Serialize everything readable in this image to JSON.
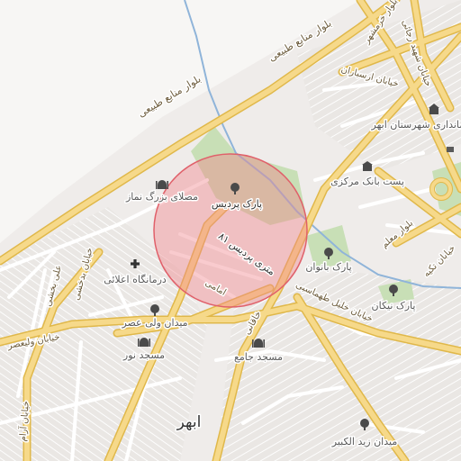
{
  "map": {
    "city_label": "ابهر",
    "colors": {
      "background": "#efecea",
      "land_white": "#f7f6f4",
      "park": "#c8dfb6",
      "water": "#8fb4d9",
      "road_major": "#f6d98a",
      "road_major_edge": "#e0b84a",
      "road_minor": "#ffffff",
      "highlight_fill": "#f1838a",
      "highlight_stroke": "#e0606a"
    },
    "roads": [
      {
        "name": "بلوار منابع طبیعی"
      },
      {
        "name": "بلوار منابع طبیعی"
      },
      {
        "name": "بلوار خرمشهر"
      },
      {
        "name": "خیابان ارسباران"
      },
      {
        "name": "بلوار معلم"
      },
      {
        "name": "خیابان تکیه"
      },
      {
        "name": "خیابان ولیعصر"
      },
      {
        "name": "خیابان بدخشی"
      },
      {
        "name": "علی بخشی"
      },
      {
        "name": "۸۱ متری پردیس"
      },
      {
        "name": "امامی"
      },
      {
        "name": "خاقانی"
      },
      {
        "name": "خیابان خلیل طهماسبی"
      },
      {
        "name": "خیابان شهید رجائی"
      },
      {
        "name": "خیابان آرام"
      },
      {
        "name": "فرمانداری شهرستان ابهر"
      }
    ],
    "pois": [
      {
        "name": "پارک پردیس",
        "icon": "tree-icon"
      },
      {
        "name": "مصلای بزرگ نماز",
        "icon": "mosque-icon"
      },
      {
        "name": "درمانگاه اعلائی",
        "icon": "cross-icon"
      },
      {
        "name": "میدان ولی عصر",
        "icon": "tree-icon"
      },
      {
        "name": "مسجد نور",
        "icon": "mosque-icon"
      },
      {
        "name": "مسجد جامع",
        "icon": "mosque-icon"
      },
      {
        "name": "پست بانک مرکزی",
        "icon": "bank-icon"
      },
      {
        "name": "پارک بانوان",
        "icon": "tree-icon"
      },
      {
        "name": "پارک نیکان",
        "icon": "tree-icon"
      },
      {
        "name": "میدان زید الکبیر",
        "icon": "tree-icon"
      },
      {
        "name": "فرمانداری شهرستان ابهر",
        "icon": "government-icon"
      }
    ]
  }
}
